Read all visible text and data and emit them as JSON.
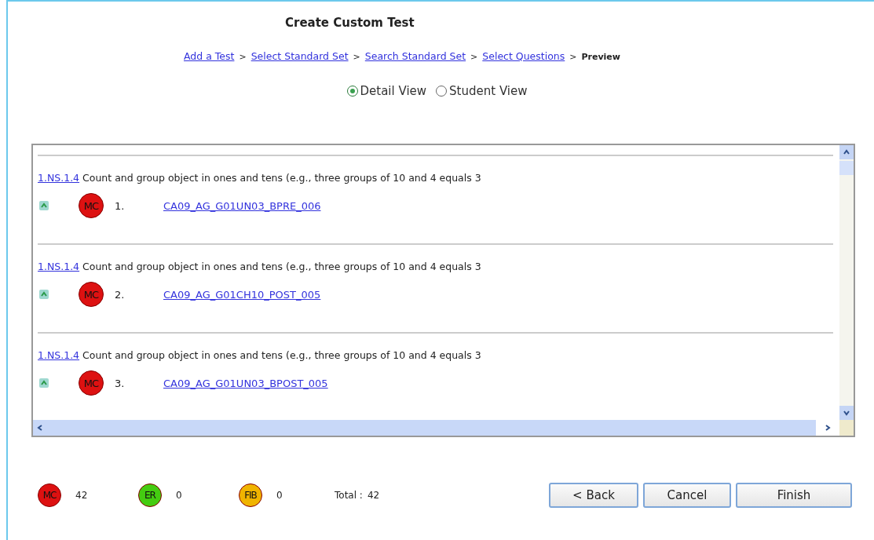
{
  "title": "Create Custom Test",
  "breadcrumb": [
    {
      "label": "Add a Test",
      "kind": "link"
    },
    {
      "label": "Select Standard Set",
      "kind": "link"
    },
    {
      "label": "Search Standard Set",
      "kind": "link"
    },
    {
      "label": "Select Questions",
      "kind": "link"
    },
    {
      "label": "Preview",
      "kind": "current"
    }
  ],
  "breadcrumb_separator": ">",
  "views": [
    {
      "label": "Detail View",
      "selected": true
    },
    {
      "label": "Student View",
      "selected": false
    }
  ],
  "questions": [
    {
      "standard": "1.NS.1.4",
      "description": "Count and group object in ones and tens (e.g., three groups of 10 and 4 equals 3",
      "badge": "MC",
      "color": "#dd1111",
      "number": "1.",
      "name": "CA09_AG_G01UN03_BPRE_006"
    },
    {
      "standard": "1.NS.1.4",
      "description": "Count and group object in ones and tens (e.g., three groups of 10 and 4 equals 3",
      "badge": "MC",
      "color": "#dd1111",
      "number": "2.",
      "name": "CA09_AG_G01CH10_POST_005"
    },
    {
      "standard": "1.NS.1.4",
      "description": "Count and group object in ones and tens (e.g., three groups of 10 and 4 equals 3",
      "badge": "MC",
      "color": "#dd1111",
      "number": "3.",
      "name": "CA09_AG_G01UN03_BPOST_005"
    }
  ],
  "counts": [
    {
      "badge": "MC",
      "color": "#dd1111",
      "count": "42"
    },
    {
      "badge": "ER",
      "color": "#44cc11",
      "count": "0"
    },
    {
      "badge": "FIB",
      "color": "#f0b400",
      "count": "0"
    }
  ],
  "total_label": "Total :",
  "total": "42",
  "buttons": [
    "< Back",
    "Cancel",
    "Finish"
  ]
}
